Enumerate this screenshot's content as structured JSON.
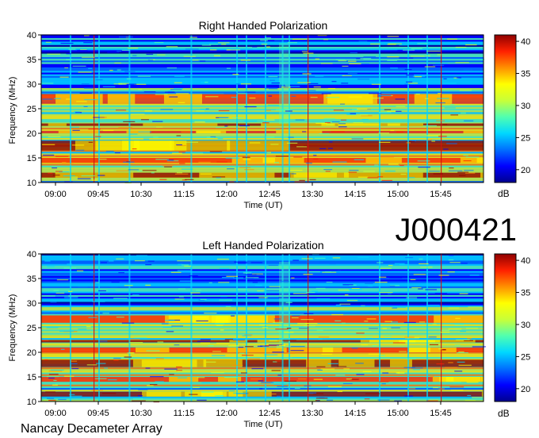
{
  "page": {
    "id_label": "J000421",
    "footer_label": "Nancay Decameter Array"
  },
  "colors": {
    "colormap": [
      "#00008f",
      "#0000ff",
      "#0070ff",
      "#00d8ff",
      "#50ffb0",
      "#c8ff38",
      "#ffff00",
      "#ff9000",
      "#ff2000",
      "#8f0000"
    ]
  },
  "chart_data": [
    {
      "type": "heatmap",
      "title": "Right Handed Polarization",
      "xlabel": "Time (UT)",
      "ylabel": "Frequency (MHz)",
      "x_ticks": [
        "09:00",
        "09:45",
        "10:30",
        "11:15",
        "12:00",
        "12:45",
        "13:30",
        "14:15",
        "15:00",
        "15:45"
      ],
      "x_range": [
        "08:45",
        "16:30"
      ],
      "y_ticks": [
        10,
        15,
        20,
        25,
        30,
        35,
        40
      ],
      "y_range": [
        10,
        40
      ],
      "colorbar": {
        "label": "dB",
        "ticks": [
          20,
          25,
          30,
          35,
          40
        ],
        "range": [
          18,
          41
        ]
      },
      "red_markers_ut": [
        "09:40",
        "13:25",
        "15:45"
      ],
      "intense_bands_mhz": [
        [
          11,
          12
        ],
        [
          14,
          15
        ],
        [
          16.5,
          18.5
        ],
        [
          20,
          20.5
        ],
        [
          21.5,
          22
        ],
        [
          26,
          28
        ]
      ]
    },
    {
      "type": "heatmap",
      "title": "Left Handed Polarization",
      "xlabel": "Time (UT)",
      "ylabel": "Frequency (MHz)",
      "x_ticks": [
        "09:00",
        "09:45",
        "10:30",
        "11:15",
        "12:00",
        "12:45",
        "13:30",
        "14:15",
        "15:00",
        "15:45"
      ],
      "x_range": [
        "08:45",
        "16:30"
      ],
      "y_ticks": [
        10,
        15,
        20,
        25,
        30,
        35,
        40
      ],
      "y_range": [
        10,
        40
      ],
      "colorbar": {
        "label": "dB",
        "ticks": [
          20,
          25,
          30,
          35,
          40
        ],
        "range": [
          18,
          41
        ]
      },
      "red_markers_ut": [
        "09:40",
        "13:25",
        "15:45"
      ],
      "intense_bands_mhz": [
        [
          11,
          12
        ],
        [
          14,
          15
        ],
        [
          17,
          18.5
        ],
        [
          20,
          21
        ],
        [
          22,
          22.5
        ],
        [
          26,
          27.5
        ]
      ]
    }
  ]
}
